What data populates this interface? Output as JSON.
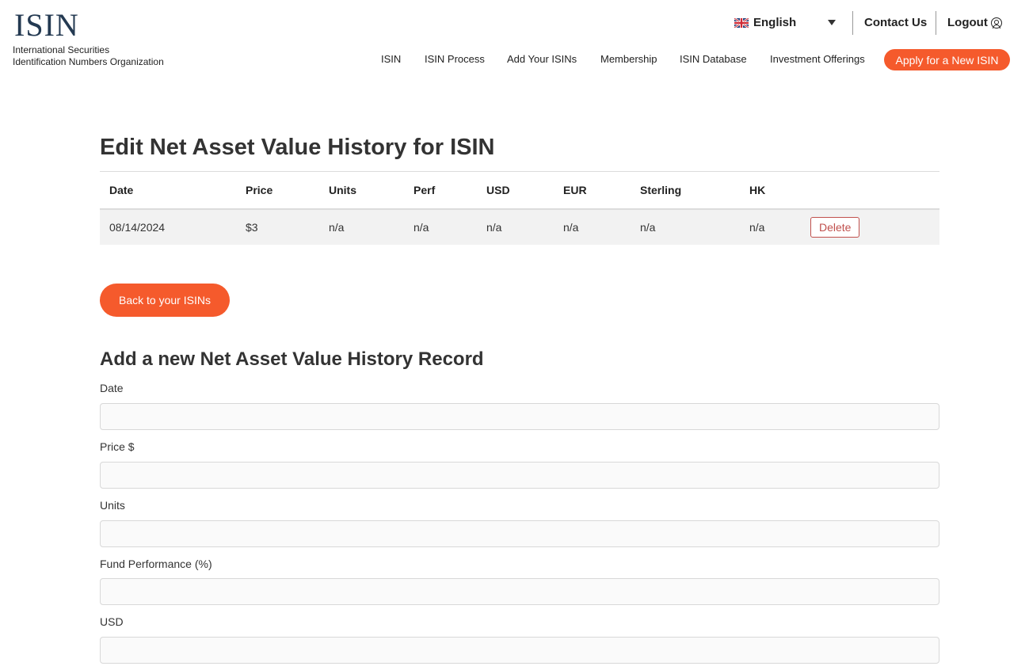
{
  "header": {
    "logo_text": "ISIN",
    "logo_subtitle_line1": "International Securities",
    "logo_subtitle_line2": "Identification Numbers Organization",
    "language": "English",
    "contact_label": "Contact Us",
    "logout_label": "Logout",
    "nav": [
      "ISIN",
      "ISIN Process",
      "Add Your ISINs",
      "Membership",
      "ISIN Database",
      "Investment Offerings"
    ],
    "apply_label": "Apply for a New ISIN"
  },
  "colors": {
    "accent": "#f55a2c",
    "delete": "#c0504d",
    "row_bg": "#f2f2f2",
    "logo": "#243a52"
  },
  "main": {
    "title": "Edit Net Asset Value History for ISIN",
    "table": {
      "columns": [
        "Date",
        "Price",
        "Units",
        "Perf",
        "USD",
        "EUR",
        "Sterling",
        "HK"
      ],
      "rows": [
        [
          "08/14/2024",
          "$3",
          "n/a",
          "n/a",
          "n/a",
          "n/a",
          "n/a",
          "n/a"
        ]
      ],
      "delete_label": "Delete"
    },
    "back_label": "Back to your ISINs"
  },
  "form": {
    "title": "Add a new Net Asset Value History Record",
    "fields": [
      {
        "label": "Date",
        "value": ""
      },
      {
        "label": "Price $",
        "value": ""
      },
      {
        "label": "Units",
        "value": ""
      },
      {
        "label": "Fund Performance (%)",
        "value": ""
      },
      {
        "label": "USD",
        "value": ""
      }
    ]
  }
}
